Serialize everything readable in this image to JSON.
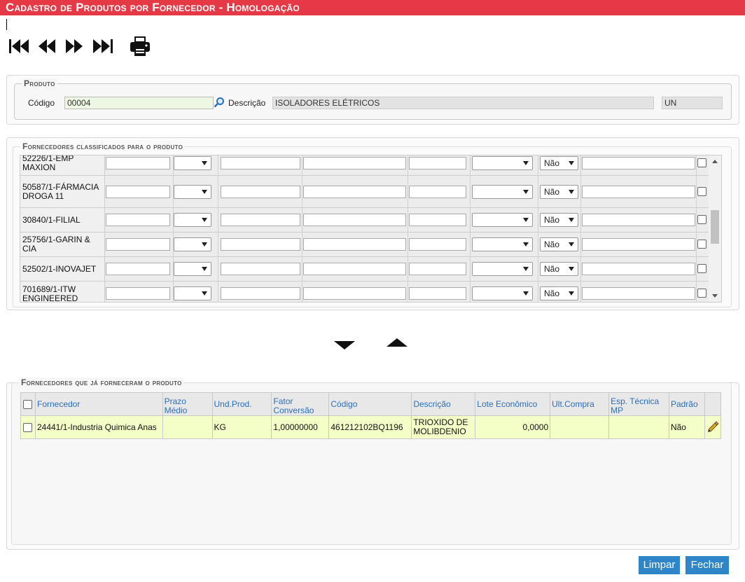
{
  "window": {
    "title": "Cadastro de Produtos por Fornecedor  - Homologação"
  },
  "toolbar": {
    "icons": [
      "first-record-icon",
      "previous-record-icon",
      "next-record-icon",
      "last-record-icon",
      "print-icon"
    ]
  },
  "produto": {
    "legend": "Produto",
    "codigo_label": "Código",
    "codigo_value": "00004",
    "descricao_label": "Descrição",
    "descricao_value": "ISOLADORES ELÉTRICOS",
    "unidade_value": "UN"
  },
  "classificados": {
    "legend": "Fornecedores classificados para o produto",
    "rows": [
      {
        "fornecedor": "52226/1-EMP MAXION",
        "padrao": "Não"
      },
      {
        "fornecedor": "50587/1-FÁRMACIA DROGA 11",
        "padrao": "Não"
      },
      {
        "fornecedor": "30840/1-FILIAL",
        "padrao": "Não"
      },
      {
        "fornecedor": "25756/1-GARIN & CIA",
        "padrao": "Não"
      },
      {
        "fornecedor": "52502/1-INOVAJET",
        "padrao": "Não"
      },
      {
        "fornecedor": "701689/1-ITW ENGINEERED",
        "padrao": "Não"
      }
    ]
  },
  "transfer": {
    "icons": [
      "move-down-icon",
      "move-up-icon"
    ]
  },
  "historico": {
    "legend": "Fornecedores que já forneceram o produto",
    "columns": [
      "Fornecedor",
      "Prazo Médio",
      "Und.Prod.",
      "Fator Conversão",
      "Código",
      "Descrição",
      "Lote Econômico",
      "Ult.Compra",
      "Esp. Técnica MP",
      "Padrão"
    ],
    "rows": [
      {
        "fornecedor": "24441/1-Industria Quimica Anas",
        "prazo_medio": "",
        "und_prod": "KG",
        "fator_conversao": "1,00000000",
        "codigo": "461212102BQ1196",
        "descricao": "TRIOXIDO DE MOLIBDENIO",
        "lote_economico": "0,0000",
        "ult_compra": "",
        "esp_tecnica": "",
        "padrao": "Não"
      }
    ]
  },
  "actions": {
    "limpar": "Limpar",
    "fechar": "Fechar"
  }
}
